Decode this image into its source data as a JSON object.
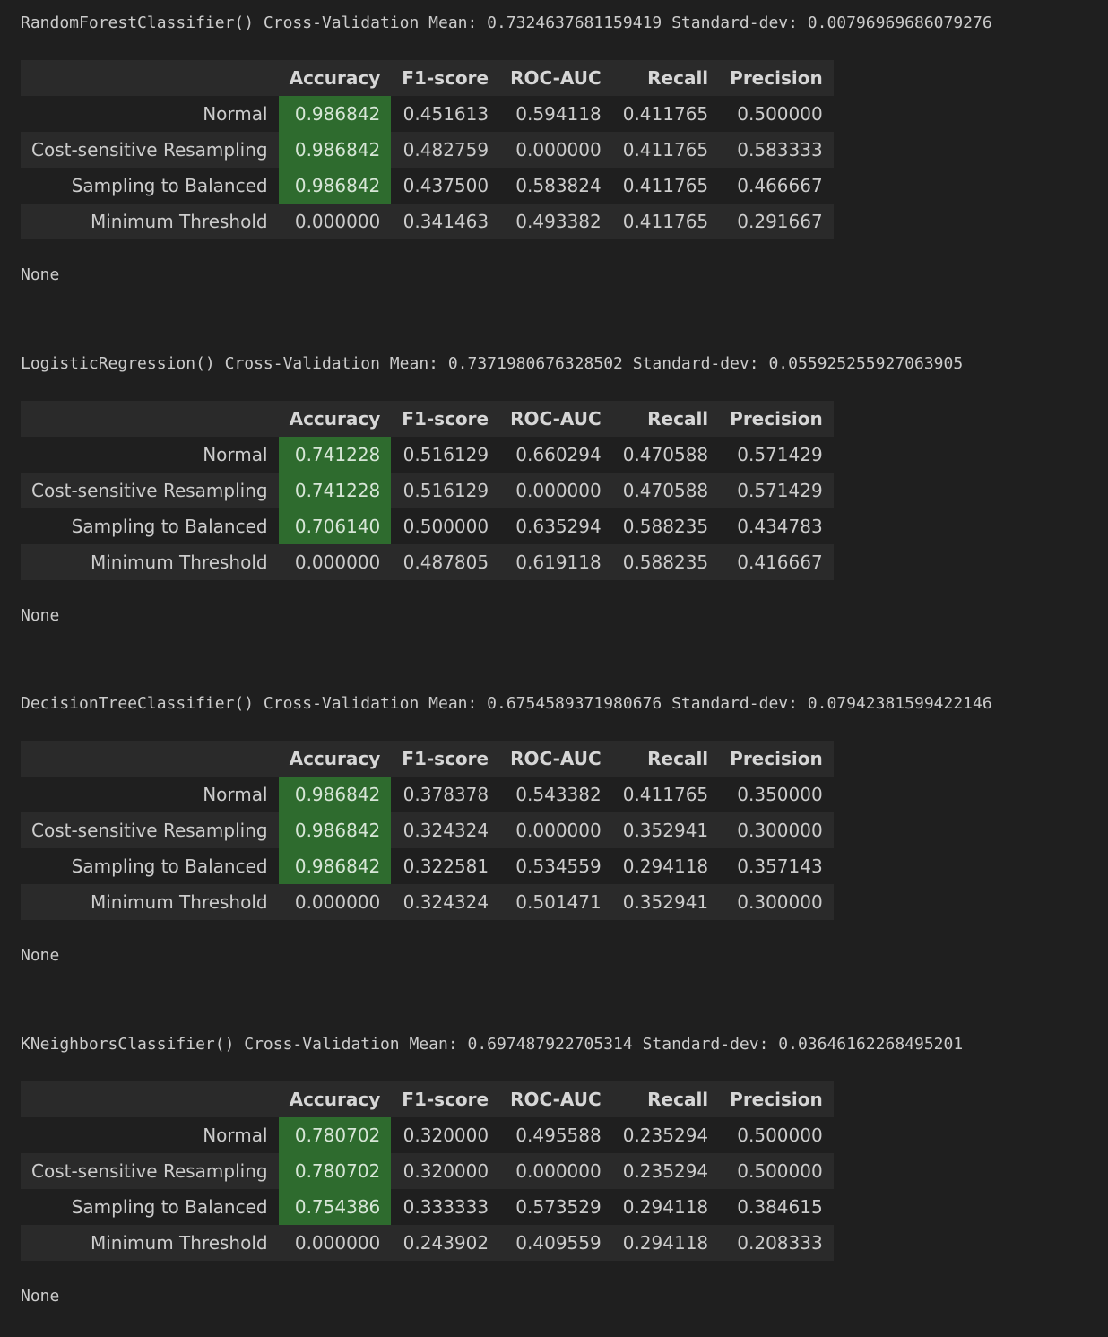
{
  "columns": [
    "Accuracy",
    "F1-score",
    "ROC-AUC",
    "Recall",
    "Precision"
  ],
  "blocks": [
    {
      "header": "RandomForestClassifier() Cross-Validation Mean: 0.7324637681159419 Standard-dev: 0.00796969686079276",
      "rows": [
        {
          "label": "Normal",
          "values": [
            "0.986842",
            "0.451613",
            "0.594118",
            "0.411765",
            "0.500000"
          ],
          "highlight_accuracy": true
        },
        {
          "label": "Cost-sensitive Resampling",
          "values": [
            "0.986842",
            "0.482759",
            "0.000000",
            "0.411765",
            "0.583333"
          ],
          "highlight_accuracy": true
        },
        {
          "label": "Sampling to Balanced",
          "values": [
            "0.986842",
            "0.437500",
            "0.583824",
            "0.411765",
            "0.466667"
          ],
          "highlight_accuracy": true
        },
        {
          "label": "Minimum Threshold",
          "values": [
            "0.000000",
            "0.341463",
            "0.493382",
            "0.411765",
            "0.291667"
          ],
          "highlight_accuracy": false
        }
      ],
      "output": "None"
    },
    {
      "header": "LogisticRegression() Cross-Validation Mean: 0.7371980676328502 Standard-dev: 0.055925255927063905",
      "rows": [
        {
          "label": "Normal",
          "values": [
            "0.741228",
            "0.516129",
            "0.660294",
            "0.470588",
            "0.571429"
          ],
          "highlight_accuracy": true
        },
        {
          "label": "Cost-sensitive Resampling",
          "values": [
            "0.741228",
            "0.516129",
            "0.000000",
            "0.470588",
            "0.571429"
          ],
          "highlight_accuracy": true
        },
        {
          "label": "Sampling to Balanced",
          "values": [
            "0.706140",
            "0.500000",
            "0.635294",
            "0.588235",
            "0.434783"
          ],
          "highlight_accuracy": true
        },
        {
          "label": "Minimum Threshold",
          "values": [
            "0.000000",
            "0.487805",
            "0.619118",
            "0.588235",
            "0.416667"
          ],
          "highlight_accuracy": false
        }
      ],
      "output": "None"
    },
    {
      "header": "DecisionTreeClassifier() Cross-Validation Mean: 0.6754589371980676 Standard-dev: 0.07942381599422146",
      "rows": [
        {
          "label": "Normal",
          "values": [
            "0.986842",
            "0.378378",
            "0.543382",
            "0.411765",
            "0.350000"
          ],
          "highlight_accuracy": true
        },
        {
          "label": "Cost-sensitive Resampling",
          "values": [
            "0.986842",
            "0.324324",
            "0.000000",
            "0.352941",
            "0.300000"
          ],
          "highlight_accuracy": true
        },
        {
          "label": "Sampling to Balanced",
          "values": [
            "0.986842",
            "0.322581",
            "0.534559",
            "0.294118",
            "0.357143"
          ],
          "highlight_accuracy": true
        },
        {
          "label": "Minimum Threshold",
          "values": [
            "0.000000",
            "0.324324",
            "0.501471",
            "0.352941",
            "0.300000"
          ],
          "highlight_accuracy": false
        }
      ],
      "output": "None"
    },
    {
      "header": "KNeighborsClassifier() Cross-Validation Mean: 0.697487922705314 Standard-dev: 0.03646162268495201",
      "rows": [
        {
          "label": "Normal",
          "values": [
            "0.780702",
            "0.320000",
            "0.495588",
            "0.235294",
            "0.500000"
          ],
          "highlight_accuracy": true
        },
        {
          "label": "Cost-sensitive Resampling",
          "values": [
            "0.780702",
            "0.320000",
            "0.000000",
            "0.235294",
            "0.500000"
          ],
          "highlight_accuracy": true
        },
        {
          "label": "Sampling to Balanced",
          "values": [
            "0.754386",
            "0.333333",
            "0.573529",
            "0.294118",
            "0.384615"
          ],
          "highlight_accuracy": true
        },
        {
          "label": "Minimum Threshold",
          "values": [
            "0.000000",
            "0.243902",
            "0.409559",
            "0.294118",
            "0.208333"
          ],
          "highlight_accuracy": false
        }
      ],
      "output": "None"
    }
  ]
}
